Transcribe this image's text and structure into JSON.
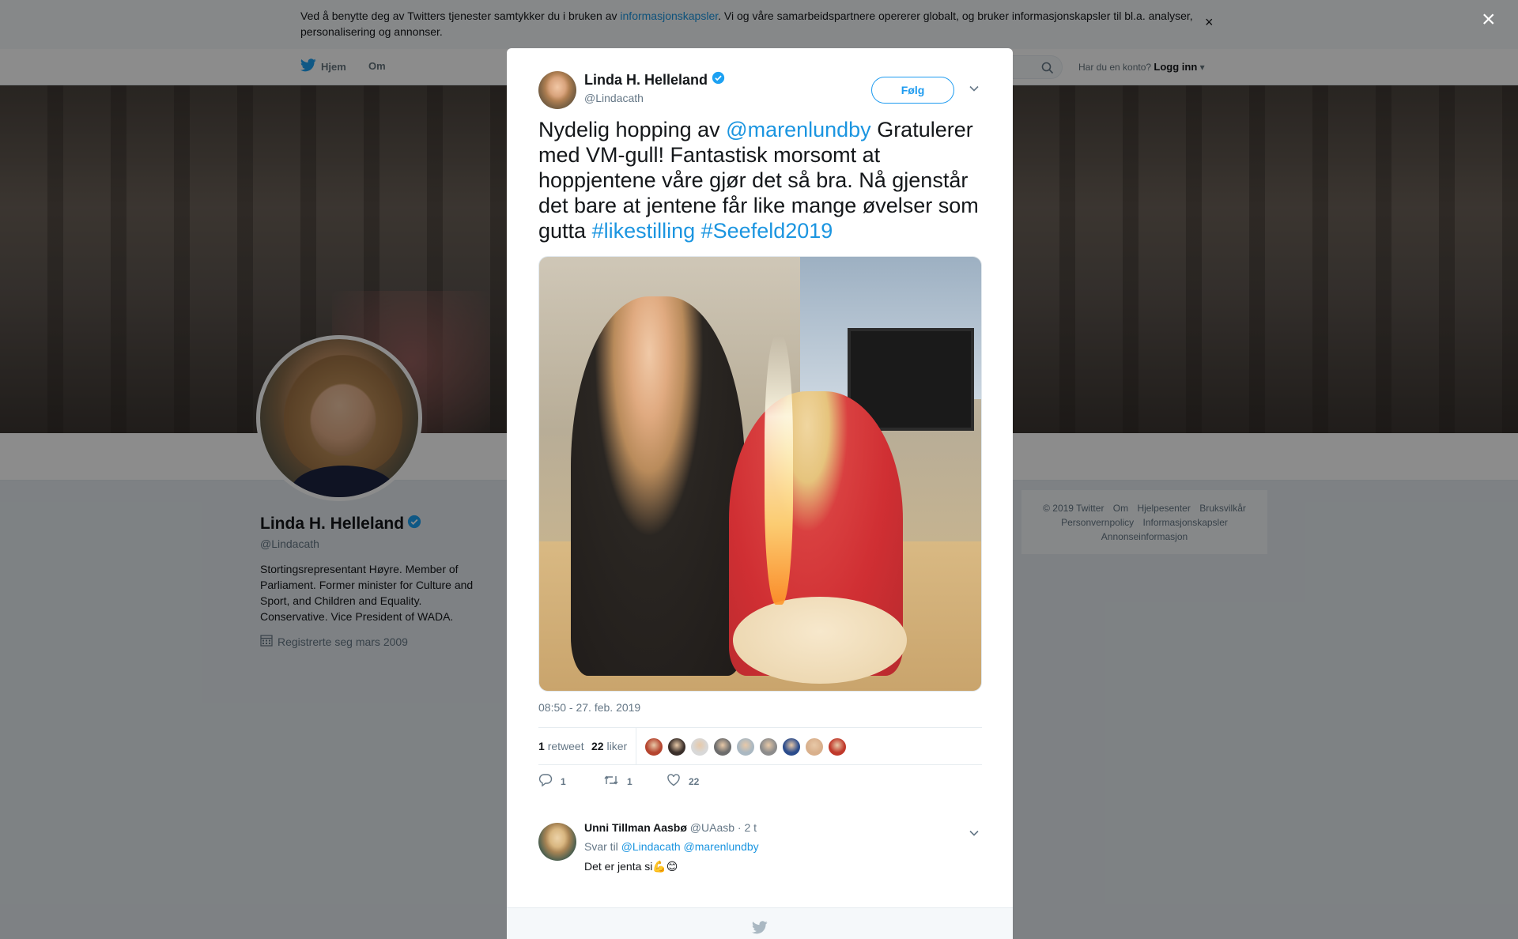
{
  "cookie_bar": {
    "text_before": "Ved å benytte deg av Twitters tjenester samtykker du i bruken av ",
    "link": "informasjonskapsler",
    "text_after": ". Vi og våre samarbeidspartnere opererer globalt, og bruker informasjonskapsler til bl.a. analyser, personalisering og annonser.",
    "close": "×"
  },
  "nav": {
    "home": "Hjem",
    "about": "Om",
    "account_prompt": "Har du en konto?",
    "login": "Logg inn"
  },
  "profile": {
    "name": "Linda H. Helleland",
    "handle": "@Lindacath",
    "bio": "Stortingsrepresentant Høyre. Member of Parliament. Former minister for Culture and Sport, and Children and Equality. Conservative. Vice President of WADA.",
    "joined": "Registrerte seg mars 2009"
  },
  "footer": {
    "links": [
      "© 2019 Twitter",
      "Om",
      "Hjelpesenter",
      "Bruksvilkår",
      "Personvernpolicy",
      "Informasjonskapsler",
      "Annonseinformasjon"
    ]
  },
  "overlay_close": "×",
  "tweet": {
    "author_name": "Linda H. Helleland",
    "author_handle": "@Lindacath",
    "follow_label": "Følg",
    "text_1": "Nydelig hopping av ",
    "mention": "@marenlundby",
    "text_2": " Gratulerer med VM-gull! Fantastisk morsomt at hoppjentene våre gjør det så bra. Nå gjenstår det bare at jentene får like mange øvelser som gutta ",
    "hashtag_1": "#likestilling",
    "hashtag_2": "#Seefeld2019",
    "timestamp": "08:50 - 27. feb. 2019",
    "retweet_count": "1",
    "retweet_label": "retweet",
    "like_count": "22",
    "like_label": "liker",
    "action_reply_count": "1",
    "action_retweet_count": "1",
    "action_like_count": "22",
    "liker_colors": [
      "#b5452f",
      "#3a2f2a",
      "#d8d8d8",
      "#6d6d6d",
      "#aab8c2",
      "#8c8c8c",
      "#2b4c8c",
      "#d9b08c",
      "#c0392b"
    ]
  },
  "reply": {
    "author_name": "Unni Tillman Aasbø",
    "author_handle": "@UAasb",
    "time": "· 2 t",
    "replying_to_label": "Svar til",
    "replying_to_1": "@Lindacath",
    "replying_to_2": "@marenlundby",
    "text": "Det er jenta si💪😊"
  },
  "colors": {
    "accent": "#1b95e0",
    "verified": "#1da1f2",
    "text_secondary": "#657786"
  }
}
